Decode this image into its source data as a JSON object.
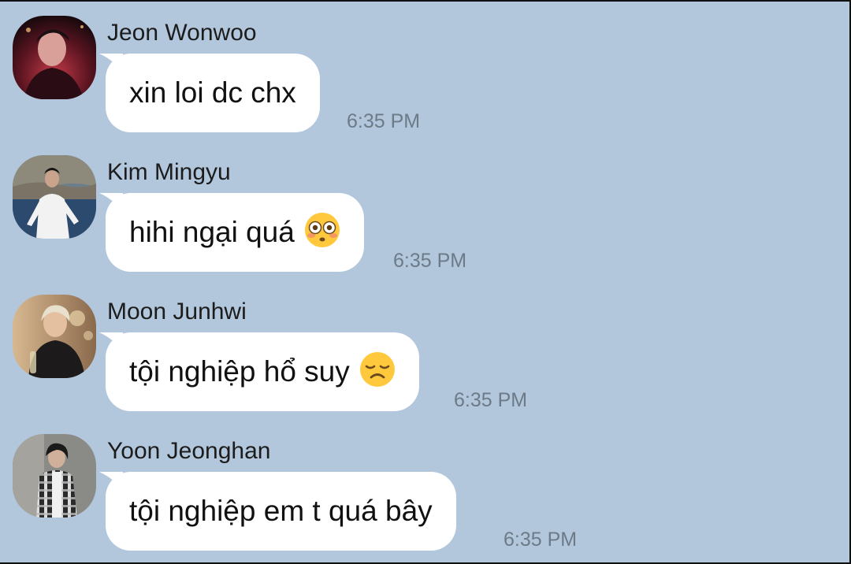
{
  "theme": {
    "chat_background": "#b2c7dc",
    "bubble_color": "#ffffff"
  },
  "messages": [
    {
      "sender": "Jeon Wonwoo",
      "text": "xin loi dc chx",
      "time": "6:35 PM",
      "avatar": "avatar-photo-dark-red",
      "emoji": null
    },
    {
      "sender": "Kim Mingyu",
      "text": "hihi ngại quá",
      "time": "6:35 PM",
      "avatar": "avatar-photo-seaside",
      "emoji": "flushed-face-emoji"
    },
    {
      "sender": "Moon Junhwi",
      "text": "tội nghiệp hổ suy",
      "time": "6:35 PM",
      "avatar": "avatar-photo-blond",
      "emoji": "disappointed-face-emoji"
    },
    {
      "sender": "Yoon Jeonghan",
      "text": "tội nghiệp em t quá bây",
      "time": "6:35 PM",
      "avatar": "avatar-photo-plaid-shirt",
      "emoji": null
    }
  ]
}
